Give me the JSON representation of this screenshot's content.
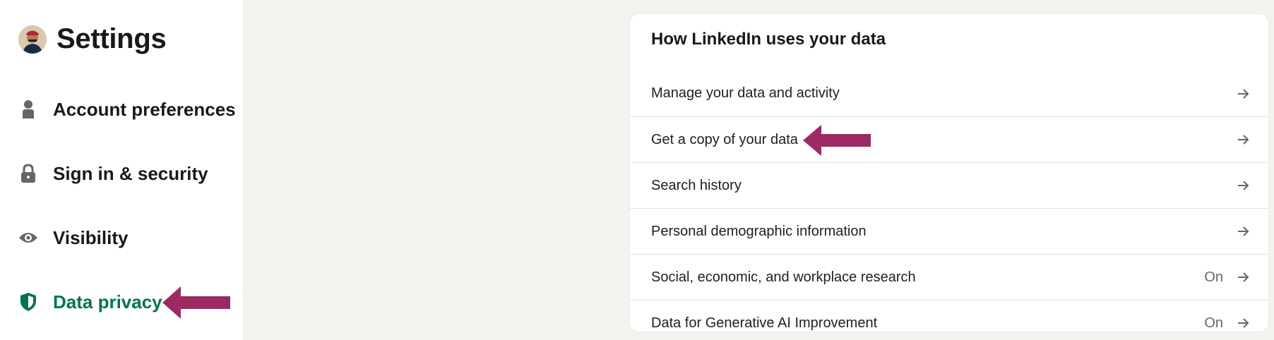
{
  "sidebar": {
    "title": "Settings",
    "items": [
      {
        "label": "Account preferences",
        "icon": "person-icon"
      },
      {
        "label": "Sign in & security",
        "icon": "lock-icon"
      },
      {
        "label": "Visibility",
        "icon": "eye-icon"
      },
      {
        "label": "Data privacy",
        "icon": "shield-icon",
        "active": true
      }
    ]
  },
  "main": {
    "section_title": "How LinkedIn uses your data",
    "rows": [
      {
        "label": "Manage your data and activity",
        "status": ""
      },
      {
        "label": "Get a copy of your data",
        "status": ""
      },
      {
        "label": "Search history",
        "status": ""
      },
      {
        "label": "Personal demographic information",
        "status": ""
      },
      {
        "label": "Social, economic, and workplace research",
        "status": "On"
      },
      {
        "label": "Data for Generative AI Improvement",
        "status": "On"
      }
    ]
  },
  "colors": {
    "active_green": "#01754f",
    "annotation_arrow": "#9c2a63",
    "background": "#f4f2ee"
  }
}
